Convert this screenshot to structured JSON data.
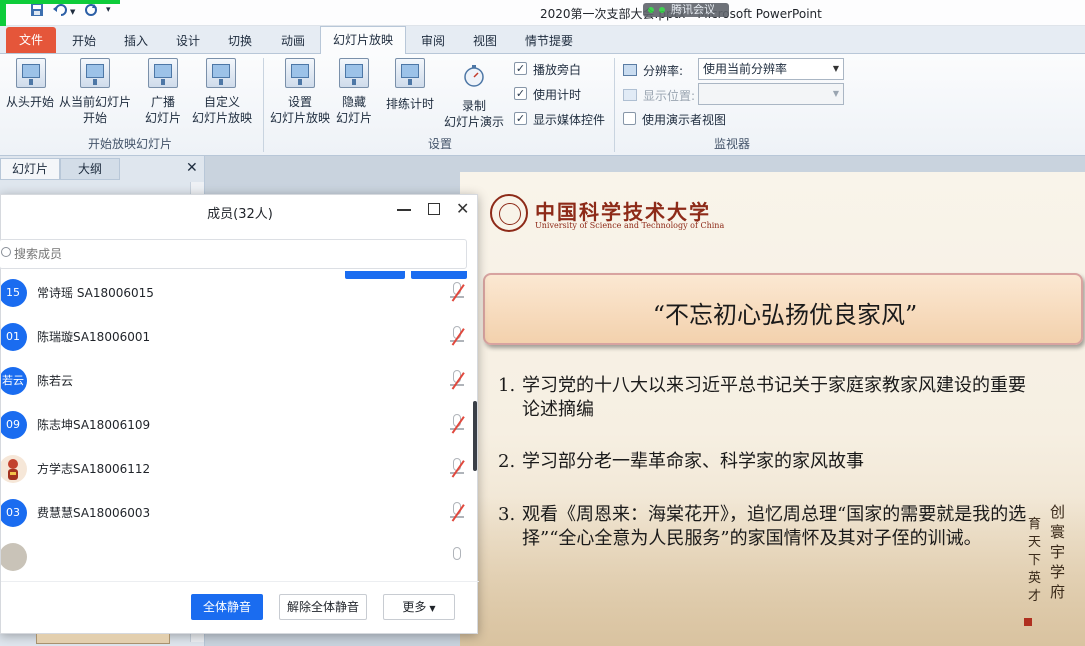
{
  "window": {
    "title": "2020第一次支部大会.pptx - Microsoft PowerPoint",
    "meeting_label": "腾讯会议"
  },
  "tabs": {
    "file": "文件",
    "items": [
      "开始",
      "插入",
      "设计",
      "切换",
      "动画",
      "幻灯片放映",
      "审阅",
      "视图",
      "情节提要"
    ],
    "active": "幻灯片放映"
  },
  "ribbon": {
    "start_group": {
      "from_start": "从头开始",
      "from_current_1": "从当前幻灯片",
      "from_current_2": "开始",
      "broadcast_1": "广播",
      "broadcast_2": "幻灯片",
      "custom_1": "自定义",
      "custom_2": "幻灯片放映",
      "label": "开始放映幻灯片"
    },
    "setup_group": {
      "setup_1": "设置",
      "setup_2": "幻灯片放映",
      "hide_1": "隐藏",
      "hide_2": "幻灯片",
      "rehearse": "排练计时",
      "record_1": "录制",
      "record_2": "幻灯片演示",
      "chk_narration": "播放旁白",
      "chk_timings": "使用计时",
      "chk_media": "显示媒体控件",
      "label": "设置"
    },
    "monitor_group": {
      "resolution_label": "分辨率:",
      "resolution_value": "使用当前分辨率",
      "show_on_label": "显示位置:",
      "presenter_view": "使用演示者视图",
      "label": "监视器"
    },
    "checks": {
      "narration": true,
      "timings": true,
      "media": true,
      "presenter": false
    }
  },
  "slide_panel": {
    "tab_slides": "幻灯片",
    "tab_outline": "大纲",
    "close": "✕"
  },
  "members": {
    "title": "成员(32人)",
    "search_placeholder": "搜索成员",
    "list": [
      {
        "avatar": "15",
        "name": "常诗瑶 SA18006015"
      },
      {
        "avatar": "01",
        "name": "陈瑞璇SA18006001"
      },
      {
        "avatar": "若云",
        "name": "陈若云"
      },
      {
        "avatar": "09",
        "name": "陈志坤SA18006109"
      },
      {
        "avatar": "",
        "name": "方学志SA18006112"
      },
      {
        "avatar": "03",
        "name": "费慧慧SA18006003"
      }
    ],
    "mute_all": "全体静音",
    "unmute_all": "解除全体静音",
    "more": "更多"
  },
  "slide": {
    "university_cn": "中国科学技术大学",
    "university_en": "University of Science and Technology of China",
    "title": "“不忘初心弘扬优良家风”",
    "points": [
      {
        "num": "1.",
        "text": "学习党的十八大以来习近平总书记关于家庭家教家风建设的重要论述摘编"
      },
      {
        "num": "2.",
        "text": "学习部分老一辈革命家、科学家的家风故事"
      },
      {
        "num": "3.",
        "text": "观看《周恩来：海棠花开》，追忆周总理“国家的需要就是我的选择”“全心全意为人民服务”的家国情怀及其对子侄的训诫。"
      }
    ],
    "calligraphy_col1": "创寰宇学府",
    "calligraphy_col2": "育天下英才"
  },
  "colors": {
    "accent_blue": "#1a6cf0",
    "file_tab": "#e5563a",
    "uni_red": "#8d2a18",
    "mic_off": "#e0483d"
  }
}
